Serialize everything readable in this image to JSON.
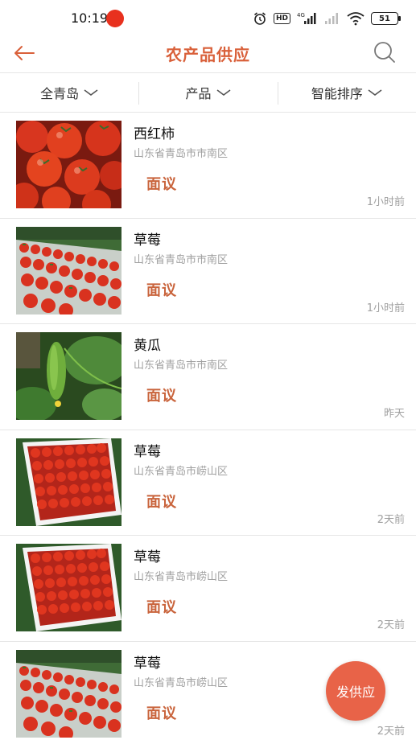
{
  "status_bar": {
    "time": "10:19",
    "network_label": "4G",
    "battery": "51"
  },
  "header": {
    "title": "农产品供应",
    "back_icon": "arrow-left-icon",
    "search_icon": "search-icon"
  },
  "filters": [
    {
      "label": "全青岛"
    },
    {
      "label": "产品"
    },
    {
      "label": "智能排序"
    }
  ],
  "items": [
    {
      "name": "西红柿",
      "location": "山东省青岛市市南区",
      "price": "面议",
      "time": "1小时前",
      "image": "tomatoes"
    },
    {
      "name": "草莓",
      "location": "山东省青岛市市南区",
      "price": "面议",
      "time": "1小时前",
      "image": "strawberries-field"
    },
    {
      "name": "黄瓜",
      "location": "山东省青岛市市南区",
      "price": "面议",
      "time": "昨天",
      "image": "cucumber"
    },
    {
      "name": "草莓",
      "location": "山东省青岛市崂山区",
      "price": "面议",
      "time": "2天前",
      "image": "strawberries-box"
    },
    {
      "name": "草莓",
      "location": "山东省青岛市崂山区",
      "price": "面议",
      "time": "2天前",
      "image": "strawberries-box"
    },
    {
      "name": "草莓",
      "location": "山东省青岛市崂山区",
      "price": "面议",
      "time": "2天前",
      "image": "strawberries-field"
    }
  ],
  "fab": {
    "label": "发供应"
  },
  "colors": {
    "accent": "#d9603a",
    "price": "#c9643c",
    "fab": "#e86348",
    "muted": "#a0a0a0"
  }
}
